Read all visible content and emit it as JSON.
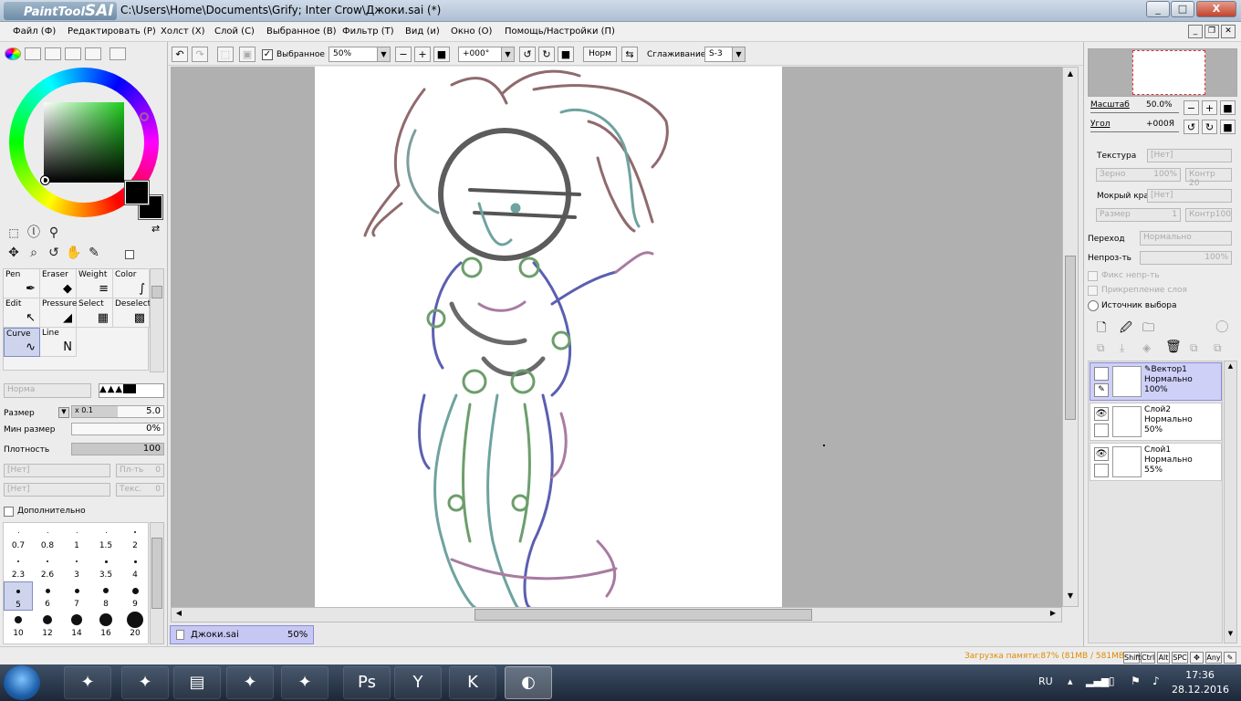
{
  "window": {
    "app_name": "PaintTool",
    "app_name_bold": "SAI",
    "title": "C:\\Users\\Home\\Documents\\Grify; Inter Crow\\Джоки.sai (*)",
    "minimize": "_",
    "maximize": "□",
    "close": "X"
  },
  "menu": [
    {
      "label": "Файл (Ф)"
    },
    {
      "label": "Редактировать (Р)"
    },
    {
      "label": "Холст (Х)"
    },
    {
      "label": "Слой (С)"
    },
    {
      "label": "Выбранное (В)"
    },
    {
      "label": "Фильтр (Т)"
    },
    {
      "label": "Вид (и)"
    },
    {
      "label": "Окно (О)"
    },
    {
      "label": "Помощь/Настройки (П)"
    }
  ],
  "toolbar": {
    "selection_checkbox_label": "Выбранное",
    "zoom": "50%",
    "angle": "+000°",
    "norm_button": "Норм",
    "smoothing_label": "Сглаживание",
    "smoothing_value": "S-3"
  },
  "brushes": [
    {
      "name": "Pen",
      "icon": "pen-icon"
    },
    {
      "name": "Eraser",
      "icon": "eraser-icon"
    },
    {
      "name": "Weight",
      "icon": "weight-icon"
    },
    {
      "name": "Color",
      "icon": "color-icon"
    },
    {
      "name": "Edit",
      "icon": "edit-icon"
    },
    {
      "name": "Pressure",
      "icon": "pressure-icon"
    },
    {
      "name": "Select",
      "icon": "select-icon"
    },
    {
      "name": "Deselect",
      "icon": "deselect-icon"
    },
    {
      "name": "Curve",
      "icon": "curve-icon",
      "selected": true
    },
    {
      "name": "Line",
      "icon": "line-icon"
    }
  ],
  "brush_settings": {
    "blend_mode": "Норма",
    "size_label": "Размер",
    "size_multiplier": "x 0.1",
    "size_value": "5.0",
    "min_size_label": "Мин размер",
    "min_size_value": "0%",
    "density_label": "Плотность",
    "density_value": "100",
    "texture1": "[Нет]",
    "texture1_right": "Пл-ть",
    "texture1_right_value": "0",
    "texture2": "[Нет]",
    "texture2_right": "Текс.",
    "texture2_right_value": "0",
    "advanced_label": "Дополнительно"
  },
  "sizes": [
    {
      "label": "0.7",
      "d": 1
    },
    {
      "label": "0.8",
      "d": 1
    },
    {
      "label": "1",
      "d": 1
    },
    {
      "label": "1.5",
      "d": 1
    },
    {
      "label": "2",
      "d": 2
    },
    {
      "label": "2.3",
      "d": 2
    },
    {
      "label": "2.6",
      "d": 2
    },
    {
      "label": "3",
      "d": 2
    },
    {
      "label": "3.5",
      "d": 3
    },
    {
      "label": "4",
      "d": 3
    },
    {
      "label": "5",
      "d": 4,
      "selected": true
    },
    {
      "label": "6",
      "d": 5
    },
    {
      "label": "7",
      "d": 5
    },
    {
      "label": "8",
      "d": 6
    },
    {
      "label": "9",
      "d": 7
    },
    {
      "label": "10",
      "d": 8
    },
    {
      "label": "12",
      "d": 10
    },
    {
      "label": "14",
      "d": 12
    },
    {
      "label": "16",
      "d": 14
    },
    {
      "label": "20",
      "d": 18
    }
  ],
  "navigator": {
    "zoom_label": "Масштаб",
    "zoom_value": "50.0%",
    "angle_label": "Угол",
    "angle_value": "+000Я"
  },
  "layer_props": {
    "texture_label": "Текстура",
    "texture_value": "[Нет]",
    "grain_label": "Зерно",
    "grain_value": "100%",
    "contrast_label": "Контр",
    "contrast_value": "20",
    "wet_label": "Мокрый край",
    "wet_value": "[Нет]",
    "size_label": "Размер",
    "size_value": "1",
    "contrast2_label": "Контр",
    "contrast2_value": "100",
    "blend_label": "Переход",
    "blend_value": "Нормально",
    "opacity_label": "Непроз-ть",
    "opacity_value": "100%",
    "fix_opacity": "Фикс непр-ть",
    "clip": "Прикрепление слоя",
    "selection_source": "Источник выбора"
  },
  "layers": [
    {
      "name": "Вектор1",
      "mode": "Нормально",
      "opacity": "100%",
      "selected": true,
      "visible": false
    },
    {
      "name": "Слой2",
      "mode": "Нормально",
      "opacity": "50%",
      "selected": false,
      "visible": true
    },
    {
      "name": "Слой1",
      "mode": "Нормально",
      "opacity": "55%",
      "selected": false,
      "visible": true
    }
  ],
  "document_tab": {
    "name": "Джоки.sai",
    "zoom": "50%"
  },
  "status": {
    "memory": "Загрузка памяти:87% (81MB / 581MB)",
    "keys": [
      "Shift",
      "Ctrl",
      "Alt",
      "SPC",
      "✥",
      "Any"
    ]
  },
  "taskbar": {
    "language": "RU",
    "time": "17:36",
    "date": "28.12.2016",
    "apps": [
      {
        "name": "pony-app-1",
        "glyph": "✦"
      },
      {
        "name": "pony-app-2",
        "glyph": "✦"
      },
      {
        "name": "file-explorer",
        "glyph": "▤"
      },
      {
        "name": "pony-app-3",
        "glyph": "✦"
      },
      {
        "name": "pony-app-4",
        "glyph": "✦"
      },
      {
        "name": "photoshop",
        "glyph": "Ps"
      },
      {
        "name": "yandex-browser",
        "glyph": "Y"
      },
      {
        "name": "kaspersky",
        "glyph": "K"
      },
      {
        "name": "painttool-sai",
        "glyph": "◐",
        "active": true
      }
    ]
  }
}
